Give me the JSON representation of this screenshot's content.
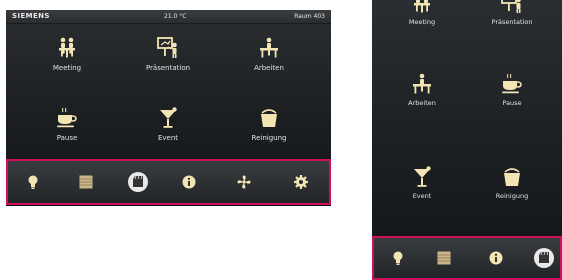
{
  "status_bar": {
    "brand": "SIEMENS",
    "temperature": "21.0 °C",
    "room": "Raum 403"
  },
  "landscape": {
    "scenes": [
      {
        "label": "Meeting",
        "icon": "meeting-icon"
      },
      {
        "label": "Präsentation",
        "icon": "presentation-icon"
      },
      {
        "label": "Arbeiten",
        "icon": "desk-icon"
      },
      {
        "label": "Pause",
        "icon": "coffee-cup-icon"
      },
      {
        "label": "Event",
        "icon": "cocktail-glass-icon"
      },
      {
        "label": "Reinigung",
        "icon": "bucket-icon"
      }
    ],
    "toolbar": [
      {
        "icon": "lightbulb-icon"
      },
      {
        "icon": "blinds-icon"
      },
      {
        "icon": "scenes-icon"
      },
      {
        "icon": "info-icon"
      },
      {
        "icon": "fan-icon"
      },
      {
        "icon": "settings-gear-icon"
      }
    ]
  },
  "portrait": {
    "scenes": [
      {
        "label": "Meeting",
        "icon": "meeting-icon"
      },
      {
        "label": "Präsentation",
        "icon": "presentation-icon"
      },
      {
        "label": "Arbeiten",
        "icon": "desk-icon"
      },
      {
        "label": "Pause",
        "icon": "coffee-cup-icon"
      },
      {
        "label": "Event",
        "icon": "cocktail-glass-icon"
      },
      {
        "label": "Reinigung",
        "icon": "bucket-icon"
      }
    ],
    "toolbar": [
      {
        "icon": "lightbulb-icon"
      },
      {
        "icon": "blinds-icon"
      },
      {
        "icon": "info-icon"
      },
      {
        "icon": "scenes-icon"
      }
    ]
  },
  "colors": {
    "accent": "#d0105e",
    "icon_gold": "#f3e4b4"
  }
}
